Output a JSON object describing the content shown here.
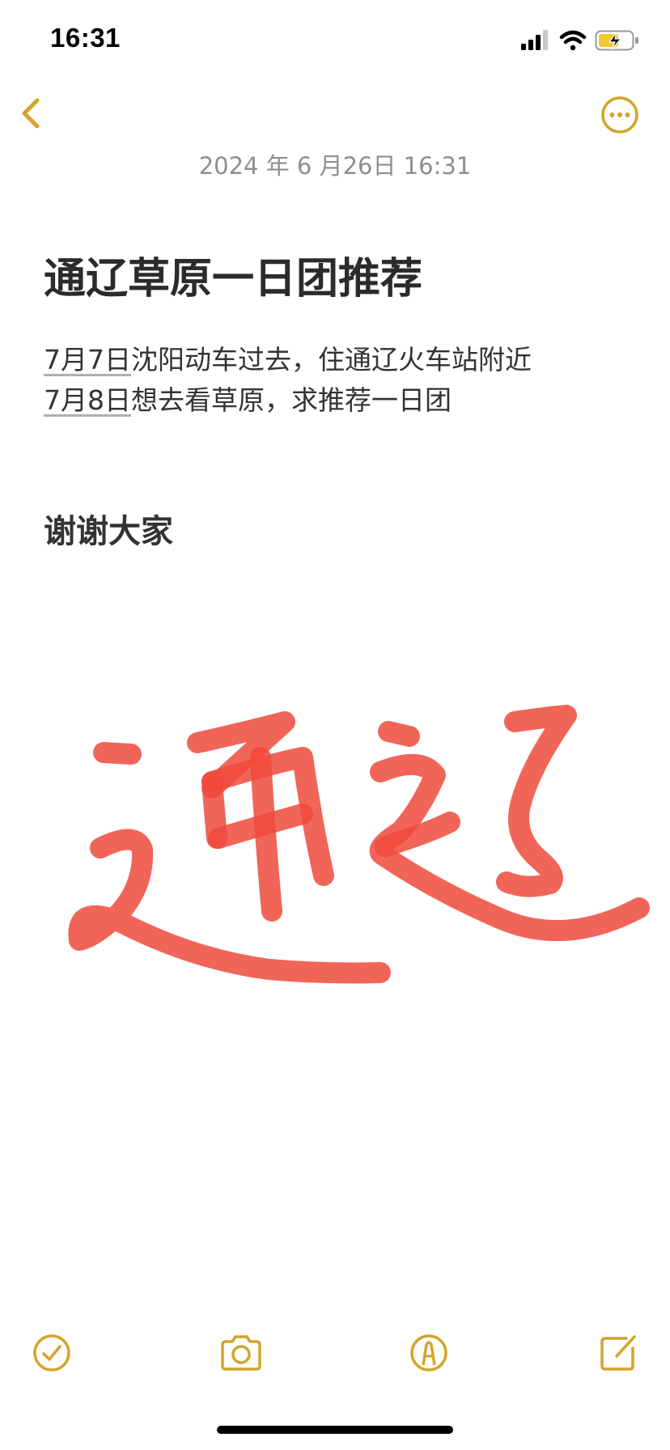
{
  "status_bar": {
    "time": "16:31"
  },
  "nav": {
    "back_icon": "chevron-left-icon",
    "more_icon": "ellipsis-circle-icon",
    "accent_color": "#d4a42a"
  },
  "note": {
    "date": "2024 年 6 月26日 16:31",
    "title": "通辽草原一日团推荐",
    "lines": [
      {
        "date": "7月7日",
        "text": "沈阳动车过去，住通辽火车站附近"
      },
      {
        "date": "7月8日",
        "text": "想去看草原，求推荐一日团"
      }
    ],
    "thanks": "谢谢大家",
    "handwriting": "通辽",
    "handwriting_color": "#ef4a3c"
  },
  "toolbar": {
    "icons": [
      "checklist-icon",
      "camera-icon",
      "markup-pen-icon",
      "compose-icon"
    ]
  }
}
